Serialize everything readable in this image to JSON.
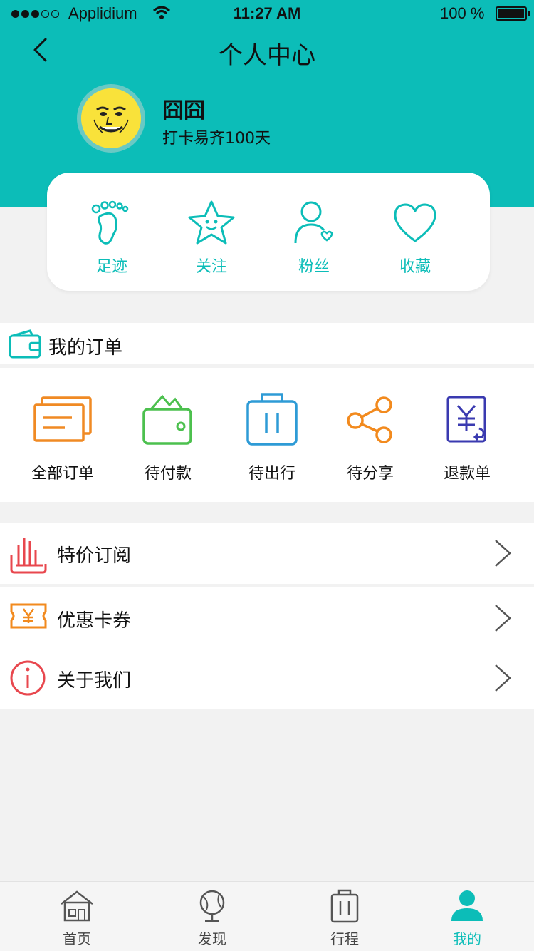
{
  "theme": {
    "accent": "#0cbdb8",
    "background": "#f2f2f2"
  },
  "status_bar": {
    "carrier": "Applidium",
    "time": "11:27 AM",
    "battery": "100 %"
  },
  "nav": {
    "title": "个人中心",
    "back_icon": "chevron-left-icon"
  },
  "profile": {
    "name": "囧囧",
    "subtitle": "打卡易齐100天",
    "avatar_icon": "face-avatar"
  },
  "quick_links": [
    {
      "label": "足迹",
      "icon": "footprint-icon"
    },
    {
      "label": "关注",
      "icon": "star-icon"
    },
    {
      "label": "粉丝",
      "icon": "fans-icon"
    },
    {
      "label": "收藏",
      "icon": "heart-icon"
    }
  ],
  "orders": {
    "title": "我的订单",
    "items": [
      {
        "label": "全部订单",
        "icon": "orders-icon",
        "color": "#f08a24"
      },
      {
        "label": "待付款",
        "icon": "wallet-icon",
        "color": "#4cc04e"
      },
      {
        "label": "待出行",
        "icon": "luggage-icon",
        "color": "#2e9bd6"
      },
      {
        "label": "待分享",
        "icon": "share-icon",
        "color": "#f28a1e"
      },
      {
        "label": "退款单",
        "icon": "refund-icon",
        "color": "#3a3ab0"
      }
    ]
  },
  "menu": [
    {
      "label": "特价订阅",
      "icon": "hot-deal-icon"
    },
    {
      "label": "优惠卡券",
      "icon": "coupon-icon"
    },
    {
      "label": "关于我们",
      "icon": "info-icon"
    }
  ],
  "tabbar": [
    {
      "label": "首页",
      "icon": "home-icon",
      "active": false
    },
    {
      "label": "发现",
      "icon": "globe-icon",
      "active": false
    },
    {
      "label": "行程",
      "icon": "luggage-icon",
      "active": false
    },
    {
      "label": "我的",
      "icon": "user-icon",
      "active": true
    }
  ]
}
